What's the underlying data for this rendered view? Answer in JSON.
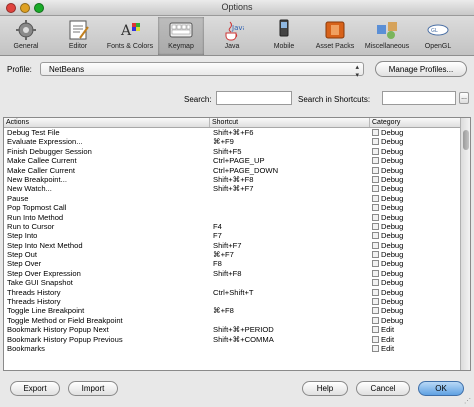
{
  "window": {
    "title": "Options"
  },
  "toolbar": {
    "items": [
      {
        "label": "General",
        "icon": "general-icon"
      },
      {
        "label": "Editor",
        "icon": "editor-icon"
      },
      {
        "label": "Fonts & Colors",
        "icon": "fonts-colors-icon"
      },
      {
        "label": "Keymap",
        "icon": "keymap-icon",
        "active": true
      },
      {
        "label": "Java",
        "icon": "java-icon"
      },
      {
        "label": "Mobile",
        "icon": "mobile-icon"
      },
      {
        "label": "Asset Packs",
        "icon": "asset-packs-icon"
      },
      {
        "label": "Miscellaneous",
        "icon": "miscellaneous-icon"
      },
      {
        "label": "OpenGL",
        "icon": "opengl-icon"
      }
    ]
  },
  "profile": {
    "label": "Profile:",
    "value": "NetBeans",
    "manage_label": "Manage Profiles..."
  },
  "search": {
    "label": "Search:",
    "value": "",
    "shortcut_label": "Search in Shortcuts:",
    "shortcut_value": "",
    "ellipsis": "..."
  },
  "table": {
    "columns": [
      "Actions",
      "Shortcut",
      "Category"
    ],
    "rows": [
      {
        "action": "Debug Test File",
        "shortcut": "Shift+⌘+F6",
        "category": "Debug"
      },
      {
        "action": "Evaluate Expression...",
        "shortcut": "⌘+F9",
        "category": "Debug"
      },
      {
        "action": "Finish Debugger Session",
        "shortcut": "Shift+F5",
        "category": "Debug"
      },
      {
        "action": "Make Callee Current",
        "shortcut": "Ctrl+PAGE_UP",
        "category": "Debug"
      },
      {
        "action": "Make Caller Current",
        "shortcut": "Ctrl+PAGE_DOWN",
        "category": "Debug"
      },
      {
        "action": "New Breakpoint...",
        "shortcut": "Shift+⌘+F8",
        "category": "Debug"
      },
      {
        "action": "New Watch...",
        "shortcut": "Shift+⌘+F7",
        "category": "Debug"
      },
      {
        "action": "Pause",
        "shortcut": "",
        "category": "Debug"
      },
      {
        "action": "Pop Topmost Call",
        "shortcut": "",
        "category": "Debug"
      },
      {
        "action": "Run Into Method",
        "shortcut": "",
        "category": "Debug"
      },
      {
        "action": "Run to Cursor",
        "shortcut": "F4",
        "category": "Debug"
      },
      {
        "action": "Step Into",
        "shortcut": "F7",
        "category": "Debug"
      },
      {
        "action": "Step Into Next Method",
        "shortcut": "Shift+F7",
        "category": "Debug"
      },
      {
        "action": "Step Out",
        "shortcut": "⌘+F7",
        "category": "Debug"
      },
      {
        "action": "Step Over",
        "shortcut": "F8",
        "category": "Debug"
      },
      {
        "action": "Step Over Expression",
        "shortcut": "Shift+F8",
        "category": "Debug"
      },
      {
        "action": "Take GUI Snapshot",
        "shortcut": "",
        "category": "Debug"
      },
      {
        "action": "Threads History",
        "shortcut": "Ctrl+Shift+T",
        "category": "Debug"
      },
      {
        "action": "Threads History",
        "shortcut": "",
        "category": "Debug"
      },
      {
        "action": "Toggle Line Breakpoint",
        "shortcut": "⌘+F8",
        "category": "Debug"
      },
      {
        "action": "Toggle Method or Field Breakpoint",
        "shortcut": "",
        "category": "Debug"
      },
      {
        "action": "Bookmark History Popup Next",
        "shortcut": "Shift+⌘+PERIOD",
        "category": "Edit"
      },
      {
        "action": "Bookmark History Popup Previous",
        "shortcut": "Shift+⌘+COMMA",
        "category": "Edit"
      },
      {
        "action": "Bookmarks",
        "shortcut": "",
        "category": "Edit"
      }
    ]
  },
  "buttons": {
    "export": "Export",
    "import": "Import",
    "help": "Help",
    "cancel": "Cancel",
    "ok": "OK"
  },
  "colors": {
    "primary_button": "#5fa1e2",
    "close": "#e0443e",
    "minimize": "#dea123",
    "zoom": "#1aab29"
  }
}
